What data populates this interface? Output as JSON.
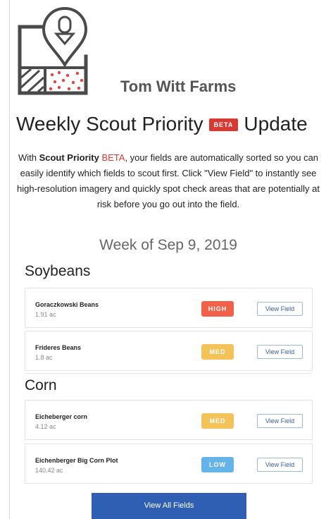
{
  "brand": {
    "farm_name": "Tom Witt Farms"
  },
  "headline": {
    "before": "Weekly Scout Priority",
    "badge": "BETA",
    "after": "Update"
  },
  "intro": {
    "part1": "With ",
    "bold": "Scout Priority",
    "beta": "BETA",
    "part2": ", your fields are automatically sorted so you can easily identify which fields to scout first. Click \"View Field\" to instantly see high-resolution imagery and quickly spot check areas that are potentially at risk before you go out into the field."
  },
  "week_label": "Week of Sep 9, 2019",
  "sections": [
    {
      "title": "Soybeans",
      "fields": [
        {
          "name": "Goraczkowski Beans",
          "acres": "1.91 ac",
          "priority": "HIGH",
          "button": "View Field"
        },
        {
          "name": "Frideres Beans",
          "acres": "1.8 ac",
          "priority": "MED",
          "button": "View Field"
        }
      ]
    },
    {
      "title": "Corn",
      "fields": [
        {
          "name": "Eicheberger corn",
          "acres": "4.12 ac",
          "priority": "MED",
          "button": "View Field"
        },
        {
          "name": "Eichenberger Big Corn Plot",
          "acres": "140.42 ac",
          "priority": "LOW",
          "button": "View Field"
        }
      ]
    }
  ],
  "priority_colors": {
    "HIGH": "#f2604a",
    "MED": "#f3c35a",
    "LOW": "#64b3e9"
  },
  "footer_button": "View All Fields"
}
